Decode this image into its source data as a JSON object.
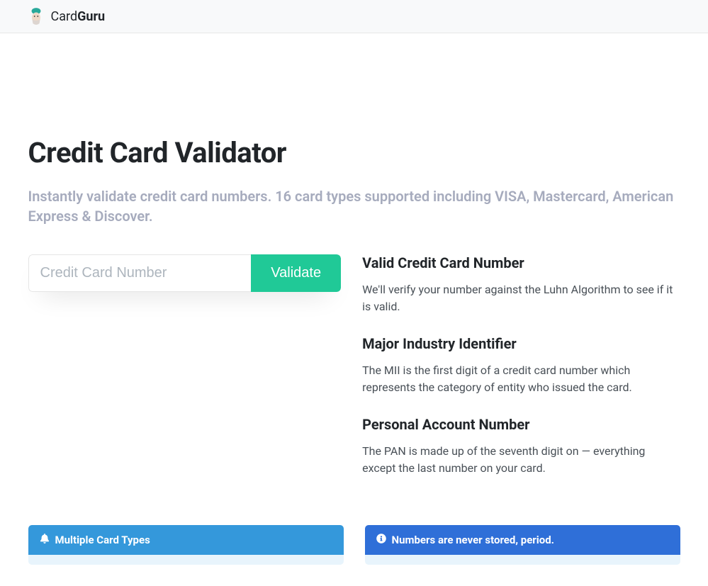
{
  "brand": {
    "part1": "Card",
    "part2": "Guru"
  },
  "hero": {
    "title": "Credit Card Validator",
    "lead": "Instantly validate credit card numbers. 16 card types supported including VISA, Mastercard, American Express & Discover."
  },
  "form": {
    "placeholder": "Credit Card Number",
    "button": "Validate"
  },
  "sections": [
    {
      "heading": "Valid Credit Card Number",
      "text": "We'll verify your number against the Luhn Algorithm to see if it is valid."
    },
    {
      "heading": "Major Industry Identifier",
      "text": "The MII is the first digit of a credit card number which represents the category of entity who issued the card."
    },
    {
      "heading": "Personal Account Number",
      "text": "The PAN is made up of the seventh digit on — everything except the last number on your card."
    }
  ],
  "cards": [
    {
      "heading": "Multiple Card Types"
    },
    {
      "heading": "Numbers are never stored, period."
    }
  ]
}
